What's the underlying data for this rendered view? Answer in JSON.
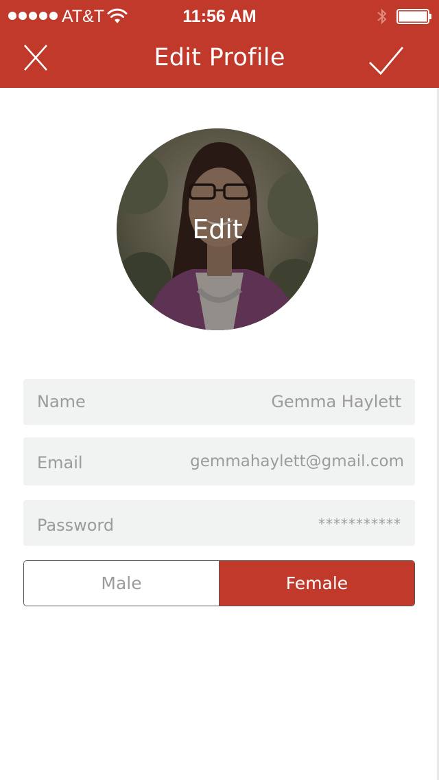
{
  "status_bar": {
    "carrier": "AT&T",
    "time": "11:56 AM",
    "signal_icon": "signal-dots-icon",
    "wifi_icon": "wifi-icon",
    "bluetooth_icon": "bluetooth-icon",
    "battery_icon": "battery-icon"
  },
  "nav": {
    "title": "Edit Profile",
    "close_icon": "close-icon",
    "done_icon": "checkmark-icon"
  },
  "avatar": {
    "edit_label": "Edit"
  },
  "form": {
    "name": {
      "label": "Name",
      "value": "Gemma Haylett"
    },
    "email": {
      "label": "Email",
      "value": "gemmahaylett@gmail.com"
    },
    "password": {
      "label": "Password",
      "value": "***********"
    }
  },
  "gender": {
    "options": [
      "Male",
      "Female"
    ],
    "selected": "Female"
  },
  "colors": {
    "brand": "#c0392b",
    "field_bg": "#f1f2f2",
    "muted_text": "#9b9b9b"
  }
}
